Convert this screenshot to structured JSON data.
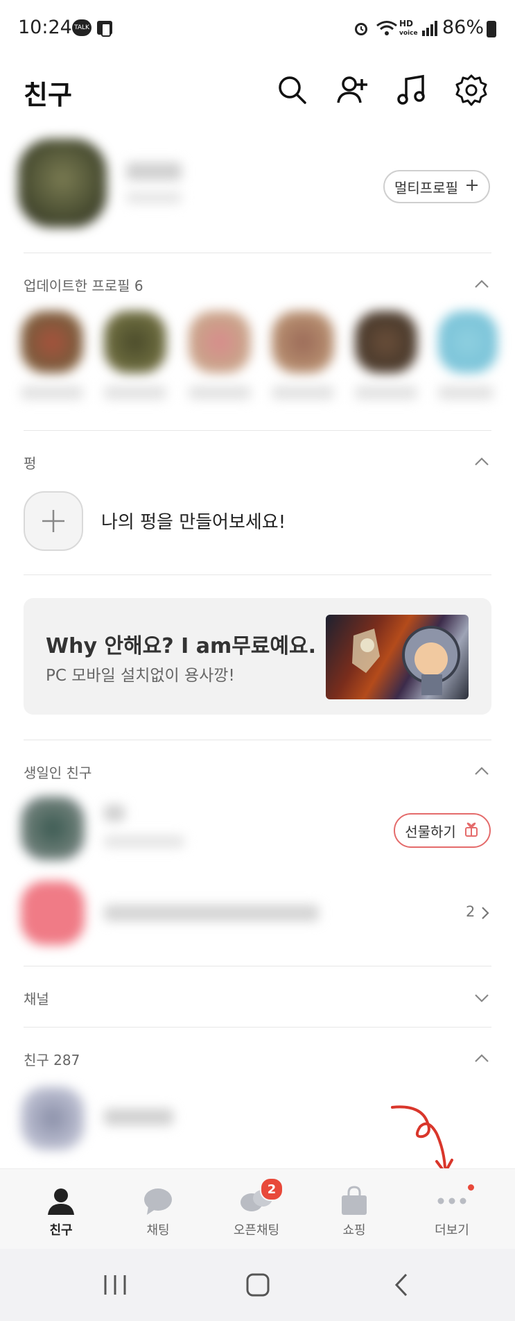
{
  "status": {
    "time": "10:24",
    "battery": "86%",
    "network": "HD"
  },
  "header": {
    "title": "친구"
  },
  "profile": {
    "multi_profile_label": "멀티프로필"
  },
  "updated": {
    "label": "업데이트한 프로필",
    "count": "6"
  },
  "pung": {
    "label": "펑",
    "cta": "나의 펑을 만들어보세요!"
  },
  "banner": {
    "title": "Why 안해요? I am무료예요.",
    "subtitle": "PC 모바일 설치없이 용사깡!"
  },
  "birthday": {
    "label": "생일인 친구",
    "gift_label": "선물하기",
    "more_count": "2"
  },
  "channel": {
    "label": "채널"
  },
  "friends": {
    "label": "친구",
    "count": "287"
  },
  "nav": {
    "items": [
      {
        "label": "친구",
        "icon": "person-icon"
      },
      {
        "label": "채팅",
        "icon": "chat-bubble-icon"
      },
      {
        "label": "오픈채팅",
        "icon": "open-chat-icon",
        "badge": "2"
      },
      {
        "label": "쇼핑",
        "icon": "shopping-bag-icon"
      },
      {
        "label": "더보기",
        "icon": "more-dots-icon"
      }
    ]
  },
  "colors": {
    "accent_red": "#e8493a",
    "gift_border": "#e46b6b",
    "annotation_red": "#d9362b"
  }
}
